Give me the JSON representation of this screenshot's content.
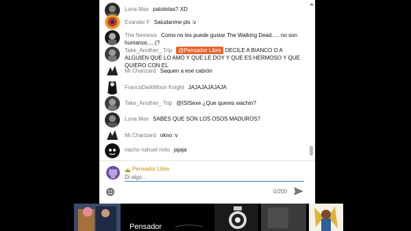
{
  "messages": [
    {
      "author": "Luna Max",
      "text": "patotetas? XD"
    },
    {
      "author": "Exander F",
      "text": "Saludanme pls :v"
    },
    {
      "author": "The Nemesis",
      "text": "Como no les puede gustar The Walking Dead..... no son humanos.....(?"
    },
    {
      "author": "Take_Another_ Trip",
      "mention": "@Pensador Libre",
      "text": "DECILE A BIANCO O A ALGUIEN QUE LO AMO Y QUE LE DOY Y QUE ES HERMOSO Y QUE QUIERO CON EL"
    },
    {
      "author": "Mr.Charizard",
      "text": "Saquen a ese cabrón"
    },
    {
      "author": "FrancoDarkMoon Knight",
      "text": "JAJAJAJAJAJA"
    },
    {
      "author": "Take_Another_ Trip",
      "text": "@ISISexe ¿Que queres wachin?"
    },
    {
      "author": "Luna Max",
      "text": "SABES QUE SON LOS OSOS MADUROS?"
    },
    {
      "author": "Mr.Charizard",
      "text": "okno :v"
    },
    {
      "author": "nacho nahuel noto",
      "text": "jajaja"
    }
  ],
  "composer": {
    "author": "Pensador Libre",
    "placeholder": "Di algo...",
    "char_count": "0/200"
  },
  "stream_label": "Pensador",
  "icons": {
    "emoji": "emoji-icon",
    "send": "send-icon",
    "badge": "owner-badge-icon"
  },
  "colors": {
    "mention_chip": "#e8622c",
    "owner_name": "#c58d00",
    "input_underline": "#3a74c9"
  }
}
